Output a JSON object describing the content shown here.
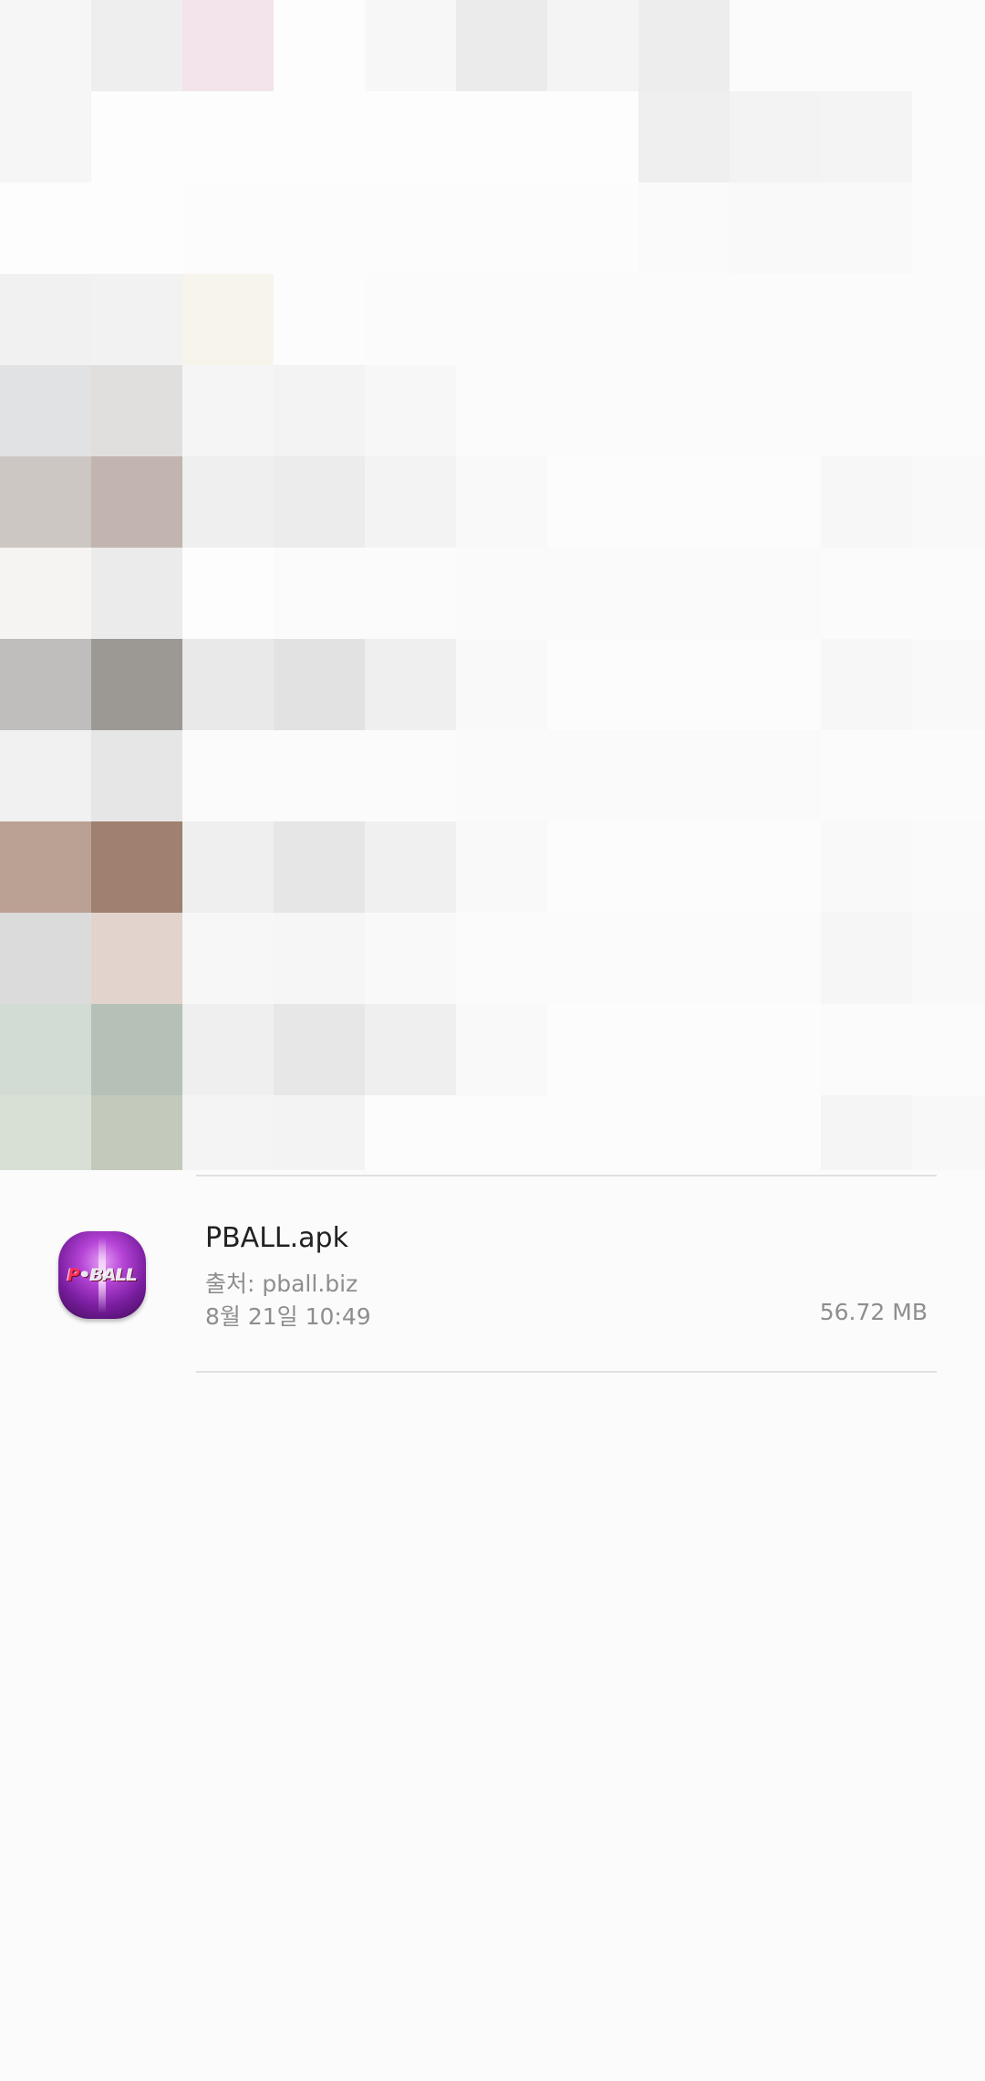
{
  "downloads": [
    {
      "file_name": "PBALL.apk",
      "source": "출처: pball.biz",
      "date": "8월 21일 10:49",
      "size": "56.72 MB",
      "icon": "pball-app-icon",
      "icon_logo_text": "P•BALL"
    }
  ],
  "colors": {
    "background": "#fbfbfb",
    "primary_text": "#222222",
    "secondary_text": "#8e8e8e",
    "divider": "#e0e0e0",
    "icon_accent": "#7a1ea0"
  }
}
